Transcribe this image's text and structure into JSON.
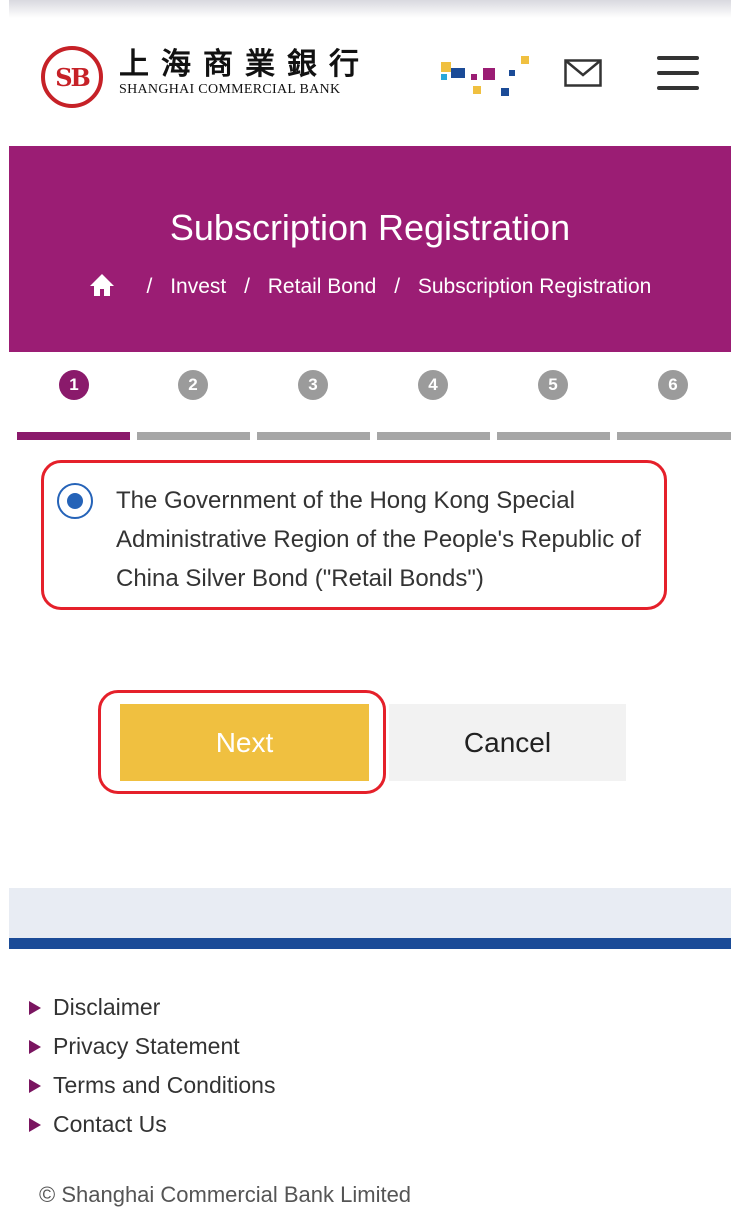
{
  "header": {
    "logo_monogram": "SB",
    "logo_cn": "上海商業銀行",
    "logo_en": "SHANGHAI COMMERCIAL BANK",
    "icons": [
      "bank-logo-icon",
      "pixel-brand-icon",
      "mail-icon",
      "menu-icon"
    ]
  },
  "banner": {
    "title": "Subscription Registration",
    "breadcrumb": {
      "sep": "/",
      "items": [
        "Invest",
        "Retail Bond",
        "Subscription Registration"
      ]
    }
  },
  "steps": {
    "items": [
      "1",
      "2",
      "3",
      "4",
      "5",
      "6"
    ],
    "active": 1
  },
  "option": {
    "label": "The Government of the Hong Kong Special Administrative Region of the People's Republic of China Silver Bond (\"Retail Bonds\")",
    "selected": true
  },
  "buttons": {
    "next": "Next",
    "cancel": "Cancel"
  },
  "footer": {
    "links": [
      "Disclaimer",
      "Privacy Statement",
      "Terms and Conditions",
      "Contact Us"
    ],
    "copyright": "© Shanghai Commercial Bank Limited"
  },
  "colors": {
    "brand_purple": "#9b1d74",
    "step_active": "#8a1a6b",
    "next_button": "#f0c040",
    "highlight_red": "#e5202a",
    "footer_blue": "#1b4b97"
  }
}
